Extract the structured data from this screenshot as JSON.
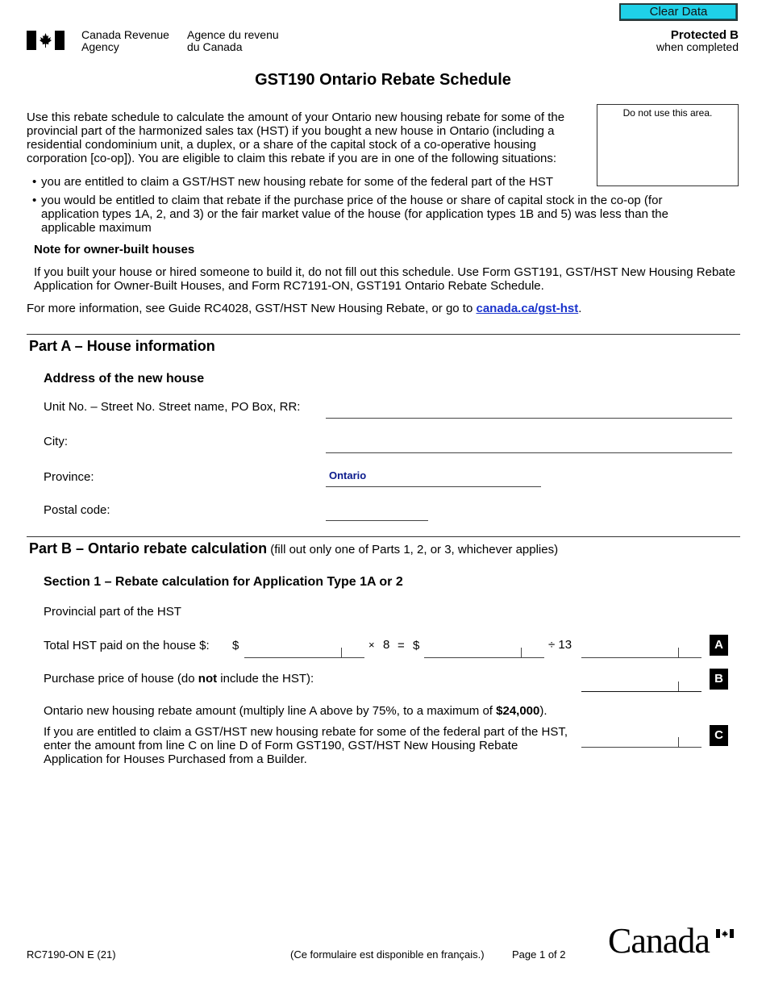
{
  "header": {
    "clear_button": "Clear Data",
    "agency_en": [
      "Canada Revenue",
      "Agency"
    ],
    "agency_fr": [
      "Agence du revenu",
      "du Canada"
    ],
    "protected": "Protected B",
    "protected_sub": "when completed",
    "flag_icon": "canada-flag-icon"
  },
  "title": "GST190 Ontario Rebate Schedule",
  "intro": {
    "paragraph": "Use this rebate schedule to calculate the amount of your Ontario new housing rebate for some of the provincial part of the harmonized sales tax (HST) if you bought a new house in Ontario (including a residential condominium unit, a duplex, or a share of the capital stock of a co-operative housing corporation [co-op]). You are eligible to claim this rebate if you are in one of the following situations:",
    "do_not_use": "Do not use this area.",
    "bullets": [
      "you are entitled to claim a GST/HST new housing rebate for some of the federal part of the HST",
      "you would be entitled to claim that rebate if the purchase price of the house or share of capital stock in the co-op (for application types 1A, 2, and 3) or the fair market value of the house (for application types 1B and 5) was less than the applicable maximum"
    ],
    "note_heading": "Note for owner-built houses",
    "note_text": "If you built your house or hired someone to build it, do not fill out this schedule. Use Form GST191, GST/HST New Housing Rebate Application for Owner-Built Houses, and Form RC7191-ON, GST191 Ontario Rebate Schedule.",
    "more_info_prefix": "For more information, see Guide RC4028, GST/HST New Housing Rebate, or go to ",
    "more_info_link": "canada.ca/gst-hst",
    "more_info_suffix": "."
  },
  "part_a": {
    "heading": "Part A – House information",
    "address_heading": "Address of the new house",
    "fields": {
      "street_label": "Unit No. – Street No. Street name, PO Box, RR:",
      "street_value": "",
      "city_label": "City:",
      "city_value": "",
      "province_label": "Province:",
      "province_value": "Ontario",
      "postal_label": "Postal code:",
      "postal_value": ""
    }
  },
  "part_b": {
    "heading": "Part B – Ontario rebate calculation",
    "subheading": " (fill out only one of Parts 1, 2, or 3, whichever applies)",
    "section1_heading": "Section 1 – Rebate calculation for Application Type 1A or 2",
    "provincial_label": "Provincial part of the HST",
    "total_hst_label": "Total HST paid on the house $:",
    "dollar": "$",
    "times": "×",
    "multiplier": "8",
    "equals": "=",
    "divide": "÷ 13",
    "line_a": "A",
    "purchase_label_pre": "Purchase price of house (do ",
    "purchase_label_bold": "not",
    "purchase_label_post": " include the HST):",
    "line_b": "B",
    "rebate_amount_pre": "Ontario new housing rebate amount (multiply line A above by 75%, to a maximum of ",
    "rebate_amount_bold": "$24,000",
    "rebate_amount_post": ").",
    "line_c_text": "If you are entitled to claim a GST/HST new housing rebate for some of the federal part of the HST, enter the amount from line C on line D of Form GST190, GST/HST New Housing Rebate Application for Houses Purchased from a Builder.",
    "line_c": "C",
    "values": {
      "total_hst": "",
      "times_result": "",
      "line_a": "",
      "line_b": "",
      "line_c": ""
    }
  },
  "footer": {
    "form_code": "RC7190-ON E (21)",
    "french_note": "(Ce formulaire est disponible en français.)",
    "page": "Page 1 of 2",
    "wordmark": "Canada"
  }
}
